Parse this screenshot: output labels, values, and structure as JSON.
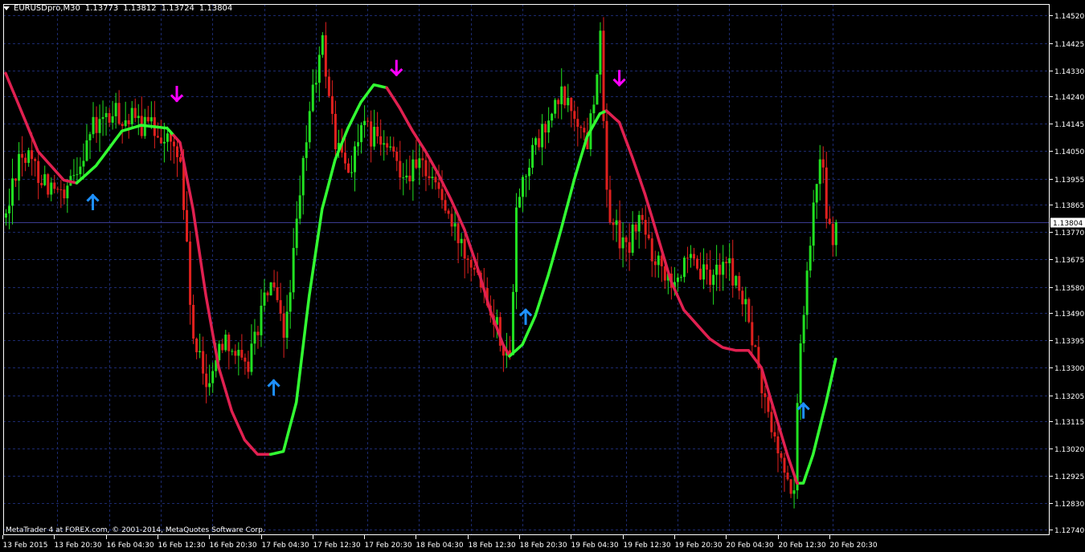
{
  "window": {
    "symbol_timeframe": "EURUSDpro,M30",
    "ohlc": [
      "1.13773",
      "1.13812",
      "1.13724",
      "1.13804"
    ]
  },
  "footer": {
    "copyright": "MetaTrader 4 at FOREX.com, © 2001-2014, MetaQuotes Software Corp."
  },
  "colors": {
    "background": "#000000",
    "grid": "#1c2a6e",
    "frame": "#ffffff",
    "candle_up": "#21e021",
    "candle_down": "#e0201e",
    "trend_up": "#32ff32",
    "trend_down": "#e02050",
    "arrow_buy": "#1e90ff",
    "arrow_sell": "#ff00ff",
    "current_price_line": "#3a3a90"
  },
  "chart_data": {
    "type": "candlestick",
    "symbol": "EURUSDpro",
    "timeframe": "M30",
    "y_ticks": [
      "1.14520",
      "1.14425",
      "1.14330",
      "1.14240",
      "1.14145",
      "1.14050",
      "1.13955",
      "1.13865",
      "1.13770",
      "1.13675",
      "1.13580",
      "1.13490",
      "1.13395",
      "1.13300",
      "1.13205",
      "1.13115",
      "1.13020",
      "1.12925",
      "1.12830",
      "1.12740"
    ],
    "ylim": [
      1.1272,
      1.1456
    ],
    "current_price": "1.13804",
    "x_ticks": [
      "13 Feb 2015",
      "13 Feb 20:30",
      "16 Feb 04:30",
      "16 Feb 12:30",
      "16 Feb 20:30",
      "17 Feb 04:30",
      "17 Feb 12:30",
      "17 Feb 20:30",
      "18 Feb 04:30",
      "18 Feb 12:30",
      "18 Feb 20:30",
      "19 Feb 04:30",
      "19 Feb 12:30",
      "19 Feb 20:30",
      "20 Feb 04:30",
      "20 Feb 12:30",
      "20 Feb 20:30"
    ],
    "bars_per_tick": 16,
    "bar_count": 258,
    "price_path": [
      [
        0,
        1.1382
      ],
      [
        4,
        1.1405
      ],
      [
        10,
        1.1398
      ],
      [
        18,
        1.1387
      ],
      [
        26,
        1.1412
      ],
      [
        34,
        1.1418
      ],
      [
        40,
        1.1415
      ],
      [
        48,
        1.1412
      ],
      [
        54,
        1.1402
      ],
      [
        58,
        1.1338
      ],
      [
        62,
        1.1325
      ],
      [
        68,
        1.1342
      ],
      [
        74,
        1.1328
      ],
      [
        78,
        1.1345
      ],
      [
        82,
        1.136
      ],
      [
        86,
        1.134
      ],
      [
        90,
        1.1378
      ],
      [
        94,
        1.142
      ],
      [
        98,
        1.1442
      ],
      [
        102,
        1.1408
      ],
      [
        106,
        1.1398
      ],
      [
        110,
        1.1412
      ],
      [
        114,
        1.141
      ],
      [
        118,
        1.1405
      ],
      [
        124,
        1.1398
      ],
      [
        130,
        1.14
      ],
      [
        134,
        1.1392
      ],
      [
        138,
        1.1378
      ],
      [
        142,
        1.1372
      ],
      [
        146,
        1.1365
      ],
      [
        150,
        1.1352
      ],
      [
        154,
        1.1338
      ],
      [
        156,
        1.1332
      ],
      [
        158,
        1.1388
      ],
      [
        162,
        1.1402
      ],
      [
        168,
        1.1415
      ],
      [
        172,
        1.1424
      ],
      [
        176,
        1.1418
      ],
      [
        180,
        1.1408
      ],
      [
        184,
        1.1443
      ],
      [
        186,
        1.1388
      ],
      [
        188,
        1.138
      ],
      [
        192,
        1.137
      ],
      [
        196,
        1.1382
      ],
      [
        200,
        1.137
      ],
      [
        206,
        1.1362
      ],
      [
        212,
        1.1365
      ],
      [
        218,
        1.136
      ],
      [
        222,
        1.1368
      ],
      [
        226,
        1.136
      ],
      [
        230,
        1.1346
      ],
      [
        234,
        1.1322
      ],
      [
        238,
        1.1305
      ],
      [
        242,
        1.129
      ],
      [
        244,
        1.1288
      ],
      [
        246,
        1.134
      ],
      [
        248,
        1.1362
      ],
      [
        250,
        1.139
      ],
      [
        252,
        1.1405
      ],
      [
        254,
        1.1385
      ],
      [
        256,
        1.137
      ],
      [
        257,
        1.13804
      ]
    ],
    "trend_line": {
      "points": [
        [
          0,
          1.1432
        ],
        [
          10,
          1.1405
        ],
        [
          18,
          1.1395
        ],
        [
          22,
          1.1394
        ],
        [
          28,
          1.14
        ],
        [
          36,
          1.1412
        ],
        [
          42,
          1.1414
        ],
        [
          50,
          1.1413
        ],
        [
          54,
          1.1408
        ],
        [
          58,
          1.1385
        ],
        [
          62,
          1.1355
        ],
        [
          66,
          1.133
        ],
        [
          70,
          1.1315
        ],
        [
          74,
          1.1305
        ],
        [
          78,
          1.13
        ],
        [
          82,
          1.13
        ],
        [
          86,
          1.1301
        ],
        [
          90,
          1.1318
        ],
        [
          94,
          1.1355
        ],
        [
          98,
          1.1385
        ],
        [
          102,
          1.1402
        ],
        [
          106,
          1.1413
        ],
        [
          110,
          1.1422
        ],
        [
          114,
          1.1428
        ],
        [
          118,
          1.1427
        ],
        [
          122,
          1.142
        ],
        [
          126,
          1.1412
        ],
        [
          130,
          1.1405
        ],
        [
          134,
          1.1397
        ],
        [
          138,
          1.1388
        ],
        [
          142,
          1.1378
        ],
        [
          146,
          1.1365
        ],
        [
          150,
          1.135
        ],
        [
          154,
          1.1338
        ],
        [
          156,
          1.1334
        ],
        [
          160,
          1.1338
        ],
        [
          164,
          1.1348
        ],
        [
          168,
          1.1362
        ],
        [
          172,
          1.1378
        ],
        [
          176,
          1.1395
        ],
        [
          180,
          1.141
        ],
        [
          184,
          1.1418
        ],
        [
          186,
          1.1419
        ],
        [
          190,
          1.1415
        ],
        [
          194,
          1.1403
        ],
        [
          198,
          1.139
        ],
        [
          202,
          1.1375
        ],
        [
          206,
          1.136
        ],
        [
          210,
          1.135
        ],
        [
          214,
          1.1345
        ],
        [
          218,
          1.134
        ],
        [
          222,
          1.1337
        ],
        [
          226,
          1.1336
        ],
        [
          230,
          1.1336
        ],
        [
          234,
          1.133
        ],
        [
          238,
          1.1315
        ],
        [
          242,
          1.13
        ],
        [
          245,
          1.129
        ],
        [
          247,
          1.129
        ],
        [
          250,
          1.13
        ],
        [
          254,
          1.1318
        ],
        [
          257,
          1.1333
        ]
      ],
      "segments": [
        {
          "from": 0,
          "to": 22,
          "trend": "down"
        },
        {
          "from": 22,
          "to": 52,
          "trend": "up"
        },
        {
          "from": 52,
          "to": 82,
          "trend": "down"
        },
        {
          "from": 82,
          "to": 118,
          "trend": "up"
        },
        {
          "from": 118,
          "to": 156,
          "trend": "down"
        },
        {
          "from": 156,
          "to": 186,
          "trend": "up"
        },
        {
          "from": 186,
          "to": 246,
          "trend": "down"
        },
        {
          "from": 246,
          "to": 257,
          "trend": "up"
        }
      ]
    },
    "signals": [
      {
        "type": "buy",
        "bar": 27,
        "price": 1.13872
      },
      {
        "type": "sell",
        "bar": 53,
        "price": 1.1425
      },
      {
        "type": "buy",
        "bar": 83,
        "price": 1.1323
      },
      {
        "type": "sell",
        "bar": 121,
        "price": 1.1434
      },
      {
        "type": "buy",
        "bar": 161,
        "price": 1.13475
      },
      {
        "type": "sell",
        "bar": 190,
        "price": 1.14305
      },
      {
        "type": "buy",
        "bar": 247,
        "price": 1.1315
      }
    ]
  }
}
